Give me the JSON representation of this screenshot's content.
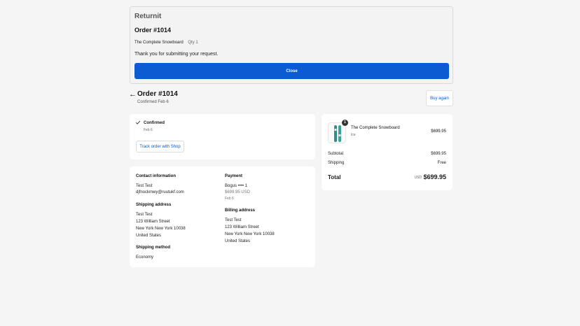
{
  "returnit": {
    "brand": "Returnit",
    "order_title": "Order #1014",
    "item_name": "The Complete Snowboard",
    "item_qty": "Qty 1",
    "thanks": "Thank you for submitting your request.",
    "close_label": "Close"
  },
  "header": {
    "title": "Order #1014",
    "subtitle": "Confirmed Feb 6",
    "buy_again": "Buy again"
  },
  "status": {
    "label": "Confirmed",
    "date": "Feb 6",
    "track_label": "Track order with Shop"
  },
  "info": {
    "contact_title": "Contact information",
    "contact_name": "Test Test",
    "contact_email": "djfnockmwy@ruutukf.com",
    "shipping_title": "Shipping address",
    "shipping_lines": [
      "Test Test",
      "123 William Street",
      "New York New York 10038",
      "United States"
    ],
    "method_title": "Shipping method",
    "method_value": "Economy",
    "payment_title": "Payment",
    "payment_card": "Bogus •••• 1",
    "payment_amount": "$699.95 USD",
    "payment_date": "Feb 6",
    "billing_title": "Billing address",
    "billing_lines": [
      "Test Test",
      "123 William Street",
      "New York New York 10038",
      "United States"
    ]
  },
  "summary": {
    "product_name": "The Complete Snowboard",
    "product_variant": "Ice",
    "product_qty_badge": "1",
    "product_price": "$699.95",
    "subtotal_label": "Subtotal",
    "subtotal_value": "$699.95",
    "shipping_label": "Shipping",
    "shipping_value": "Free",
    "total_label": "Total",
    "total_currency": "USD",
    "total_value": "$699.95"
  },
  "colors": {
    "accent": "#0b5bd3",
    "background": "#f5f5f5",
    "card": "#ffffff"
  },
  "icons": [
    "arrow-left-icon",
    "checkmark-icon",
    "snowboard-image"
  ]
}
